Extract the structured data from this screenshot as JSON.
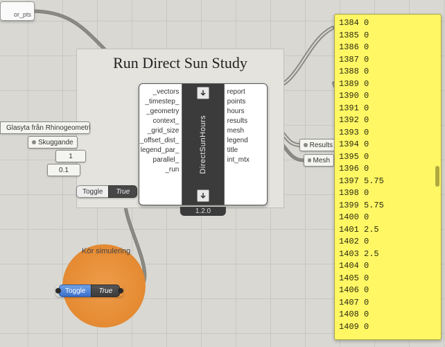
{
  "topleft": {
    "label": "or_pts"
  },
  "group": {
    "title": "Run Direct Sun Study"
  },
  "component": {
    "name": "DirectSunHours",
    "version": "1.2.0",
    "inputs": [
      "_vectors",
      "_timestep_",
      "_geometry",
      "context_",
      "_grid_size",
      "_offset_dist_",
      "legend_par_",
      "parallel_",
      "_run"
    ],
    "outputs": [
      "report",
      "points",
      "hours",
      "results",
      "mesh",
      "legend",
      "title",
      "int_mtx"
    ]
  },
  "params": {
    "glass": "Glasyta från Rhinogeometri",
    "shade": "Skuggande",
    "slider1": "1",
    "slider2": "0.1",
    "toggle_label": "Toggle",
    "toggle_value": "True",
    "results": "Results",
    "mesh": "Mesh"
  },
  "scribble": {
    "label": "Kör simulering"
  },
  "toggle2": {
    "label": "Toggle",
    "value": "True"
  },
  "panel": {
    "rows": [
      {
        "idx": "1384",
        "val": "0"
      },
      {
        "idx": "1385",
        "val": "0"
      },
      {
        "idx": "1386",
        "val": "0"
      },
      {
        "idx": "1387",
        "val": "0"
      },
      {
        "idx": "1388",
        "val": "0"
      },
      {
        "idx": "1389",
        "val": "0"
      },
      {
        "idx": "1390",
        "val": "0"
      },
      {
        "idx": "1391",
        "val": "0"
      },
      {
        "idx": "1392",
        "val": "0"
      },
      {
        "idx": "1393",
        "val": "0"
      },
      {
        "idx": "1394",
        "val": "0"
      },
      {
        "idx": "1395",
        "val": "0"
      },
      {
        "idx": "1396",
        "val": "0"
      },
      {
        "idx": "1397",
        "val": "5.75"
      },
      {
        "idx": "1398",
        "val": "0"
      },
      {
        "idx": "1399",
        "val": "5.75"
      },
      {
        "idx": "1400",
        "val": "0"
      },
      {
        "idx": "1401",
        "val": "2.5"
      },
      {
        "idx": "1402",
        "val": "0"
      },
      {
        "idx": "1403",
        "val": "2.5"
      },
      {
        "idx": "1404",
        "val": "0"
      },
      {
        "idx": "1405",
        "val": "0"
      },
      {
        "idx": "1406",
        "val": "0"
      },
      {
        "idx": "1407",
        "val": "0"
      },
      {
        "idx": "1408",
        "val": "0"
      },
      {
        "idx": "1409",
        "val": "0"
      }
    ]
  }
}
